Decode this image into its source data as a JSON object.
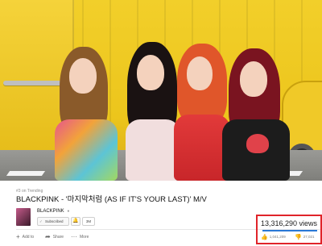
{
  "video": {
    "scene": "four-members-yellow-wall"
  },
  "trending_tag": "#3 on Trending",
  "video_title": "BLACKPINK - '마지막처럼 (AS IF IT'S YOUR LAST)' M/V",
  "channel": {
    "name": "BLACKPINK",
    "subscribe_label": "Subscribed",
    "subscriber_count": "3M",
    "bell_icon": "bell-icon"
  },
  "actions": {
    "add_to_label": "Add to",
    "share_label": "Share",
    "more_label": "More"
  },
  "stats": {
    "views": "13,316,290 views",
    "likes": "1,041,209",
    "dislikes": "27,021",
    "highlight_color": "#e0242a",
    "bar_color": "#2a78d6"
  }
}
